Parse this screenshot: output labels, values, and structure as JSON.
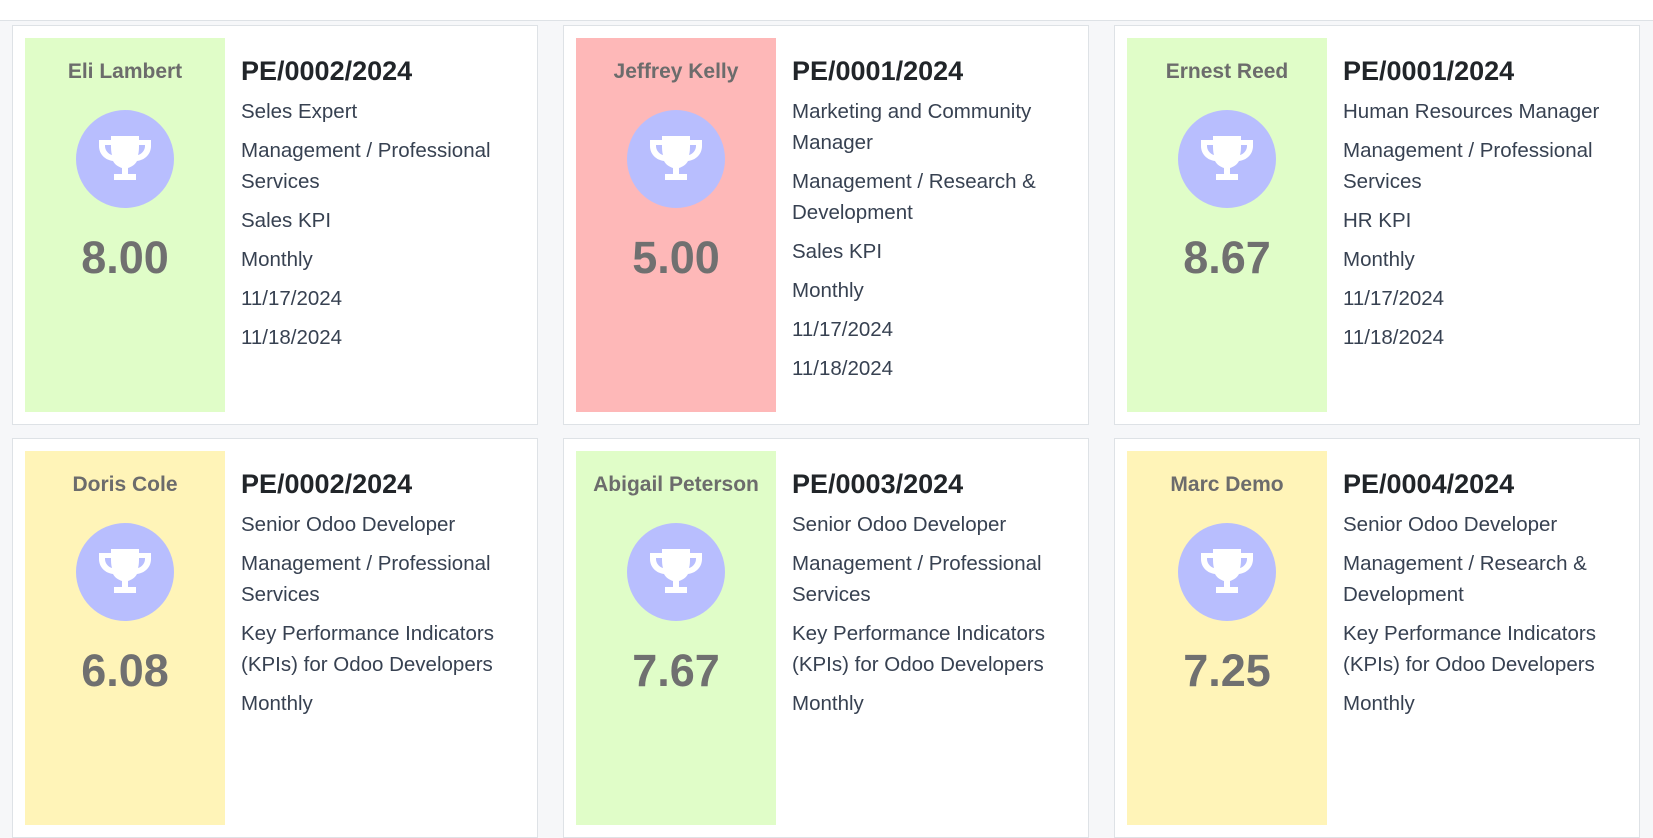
{
  "cards": [
    {
      "name": "Eli Lambert",
      "score": "8.00",
      "ref": "PE/0002/2024",
      "job": "Seles Expert",
      "department": "Management / Professional Services",
      "kpi": "Sales KPI",
      "frequency": "Monthly",
      "start": "11/17/2024",
      "end": "11/18/2024",
      "color": "#e0fdc8"
    },
    {
      "name": "Jeffrey Kelly",
      "score": "5.00",
      "ref": "PE/0001/2024",
      "job": "Marketing and Community Manager",
      "department": "Management / Research & Development",
      "kpi": "Sales KPI",
      "frequency": "Monthly",
      "start": "11/17/2024",
      "end": "11/18/2024",
      "color": "#feb8b8"
    },
    {
      "name": "Ernest Reed",
      "score": "8.67",
      "ref": "PE/0001/2024",
      "job": "Human Resources Manager",
      "department": "Management / Professional Services",
      "kpi": "HR KPI",
      "frequency": "Monthly",
      "start": "11/17/2024",
      "end": "11/18/2024",
      "color": "#e0fdc8"
    },
    {
      "name": "Doris Cole",
      "score": "6.08",
      "ref": "PE/0002/2024",
      "job": "Senior Odoo Developer",
      "department": "Management / Professional Services",
      "kpi": "Key Performance Indicators (KPIs) for Odoo Developers",
      "frequency": "Monthly",
      "color": "#fff4b8"
    },
    {
      "name": "Abigail Peterson",
      "score": "7.67",
      "ref": "PE/0003/2024",
      "job": "Senior Odoo Developer",
      "department": "Management / Professional Services",
      "kpi": "Key Performance Indicators (KPIs) for Odoo Developers",
      "frequency": "Monthly",
      "color": "#e0fdc8"
    },
    {
      "name": "Marc Demo",
      "score": "7.25",
      "ref": "PE/0004/2024",
      "job": "Senior Odoo Developer",
      "department": "Management / Research & Development",
      "kpi": "Key Performance Indicators (KPIs) for Odoo Developers",
      "frequency": "Monthly",
      "color": "#fff4b8"
    }
  ],
  "icons": {
    "trophy": "trophy-icon",
    "trophy_bg": "#b8befe"
  }
}
